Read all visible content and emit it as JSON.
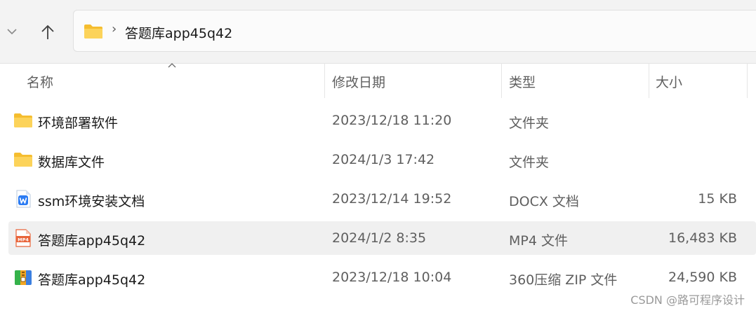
{
  "address_bar": {
    "path": "答题库app45q42",
    "separator": "›"
  },
  "columns": {
    "name": "名称",
    "date": "修改日期",
    "type": "类型",
    "size": "大小"
  },
  "files": [
    {
      "name": "环境部署软件",
      "date": "2023/12/18 11:20",
      "type": "文件夹",
      "size": "",
      "icon": "folder-icon"
    },
    {
      "name": "数据库文件",
      "date": "2024/1/3 17:42",
      "type": "文件夹",
      "size": "",
      "icon": "folder-icon"
    },
    {
      "name": "ssm环境安装文档",
      "date": "2023/12/14 19:52",
      "type": "DOCX 文档",
      "size": "15 KB",
      "icon": "wps-docx-icon"
    },
    {
      "name": "答题库app45q42",
      "date": "2024/1/2 8:35",
      "type": "MP4 文件",
      "size": "16,483 KB",
      "icon": "mp4-file-icon",
      "selected": true
    },
    {
      "name": "答题库app45q42",
      "date": "2023/12/18 10:04",
      "type": "360压缩 ZIP 文件",
      "size": "24,590 KB",
      "icon": "zip-archive-icon"
    }
  ],
  "watermark": "CSDN @路可程序设计",
  "colors": {
    "toolbar_bg": "#f3f3f3",
    "selected_row": "#f0f0f0",
    "folder": "#f8c93c",
    "wps_blue": "#2b7bf3",
    "mp4_orange": "#e8643a"
  }
}
